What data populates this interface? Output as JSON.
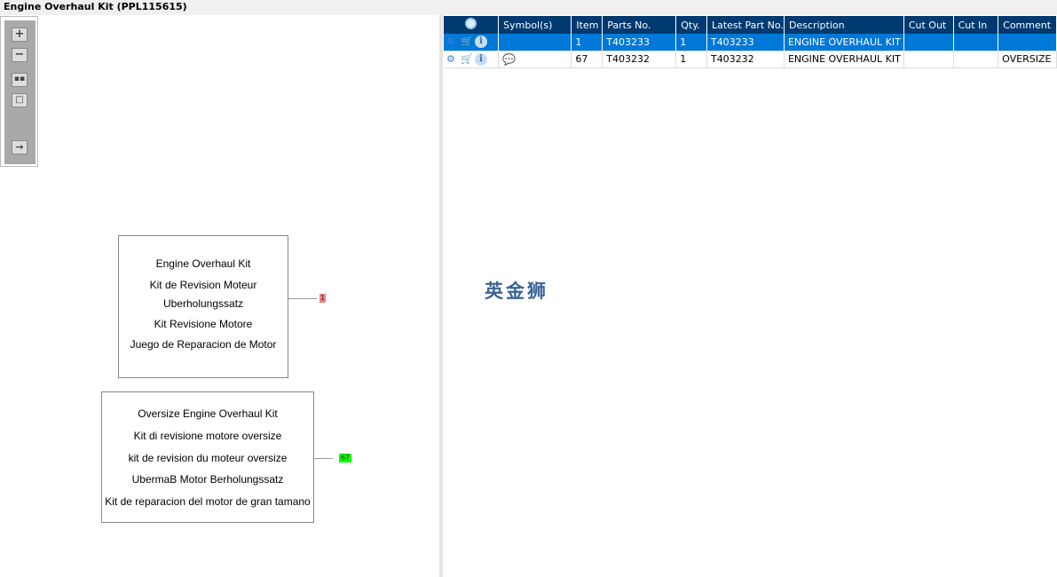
{
  "window": {
    "title": "Engine Overhaul Kit (PPL115615)"
  },
  "toolbar": {
    "icons": [
      "zoom-in-icon",
      "zoom-out-icon",
      "fit-all-icon",
      "fit-window-icon",
      "export-icon"
    ]
  },
  "diagram": {
    "boxes": [
      {
        "lines": [
          "Engine Overhaul Kit",
          "Kit de Revision Moteur",
          "Uberholungssatz",
          "Kit Revisione Motore",
          "Juego de Reparacion de Motor"
        ],
        "callout": "1",
        "callout_color": "#f08080"
      },
      {
        "lines": [
          "Oversize Engine Overhaul Kit",
          "Kit di revisione motore oversize",
          "kit de revision du moteur oversize",
          "UbermaB Motor Berholungssatz",
          "Kit de reparacion del motor de gran tamano"
        ],
        "callout": "67",
        "callout_color": "#00ff00"
      }
    ]
  },
  "table": {
    "columns": [
      "Symbol(s)",
      "Item",
      "Parts No.",
      "Qty.",
      "Latest Part No.",
      "Description",
      "Cut Out",
      "Cut In",
      "Comment"
    ],
    "rows": [
      {
        "symbol": "",
        "item": "1",
        "parts_no": "T403233",
        "qty": "1",
        "latest": "T403233",
        "description": "ENGINE OVERHAUL KIT",
        "cut_out": "",
        "cut_in": "",
        "comment": ""
      },
      {
        "symbol": "note-icon",
        "item": "67",
        "parts_no": "T403232",
        "qty": "1",
        "latest": "T403232",
        "description": "ENGINE OVERHAUL KIT",
        "cut_out": "",
        "cut_in": "",
        "comment": "OVERSIZE"
      }
    ]
  },
  "watermark": "英金狮",
  "colors": {
    "header": "#003a70",
    "selected": "#0078d7"
  }
}
